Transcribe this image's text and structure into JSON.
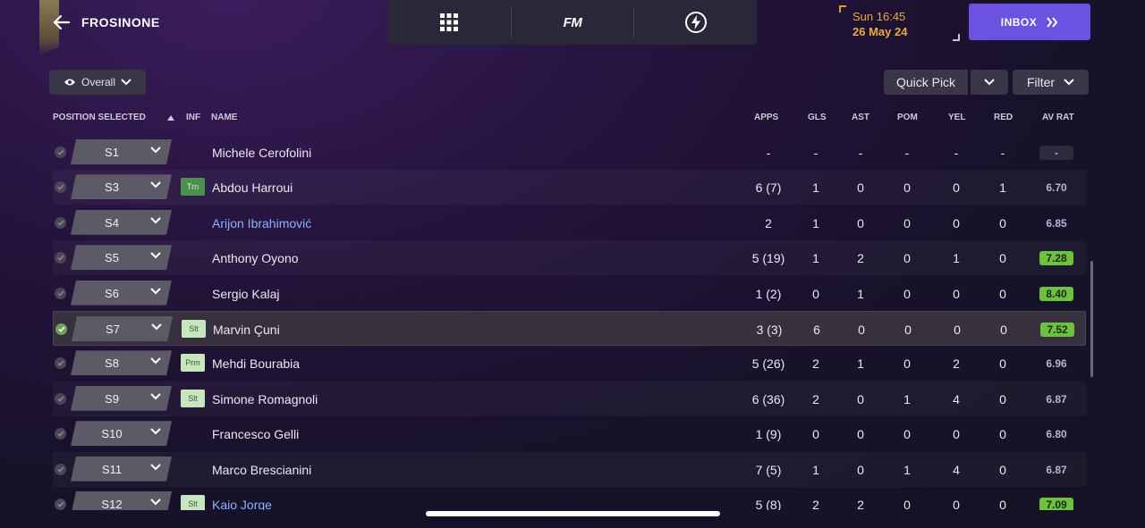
{
  "header": {
    "team_name": "FROSINONE",
    "fm_label": "FM",
    "date_time": "Sun 16:45",
    "date_day": "26 May 24",
    "inbox_label": "INBOX"
  },
  "toolbar": {
    "view_label": "Overall",
    "quick_pick_label": "Quick Pick",
    "filter_label": "Filter"
  },
  "columns": {
    "position": "POSITION SELECTED",
    "inf": "INF",
    "name": "NAME",
    "apps": "APPS",
    "gls": "GLS",
    "ast": "AST",
    "pom": "POM",
    "yel": "YEL",
    "red": "RED",
    "avrat": "AV RAT"
  },
  "players": [
    {
      "pos": "S1",
      "inf": "",
      "name": "Michele Cerofolini",
      "link": false,
      "apps": "-",
      "gls": "-",
      "ast": "-",
      "pom": "-",
      "yel": "-",
      "red": "-",
      "rat": "-",
      "rat_style": "muted",
      "selected": false
    },
    {
      "pos": "S3",
      "inf": "Trn",
      "name": "Abdou Harroui",
      "link": false,
      "apps": "6 (7)",
      "gls": "1",
      "ast": "0",
      "pom": "0",
      "yel": "0",
      "red": "1",
      "rat": "6.70",
      "rat_style": "plain",
      "selected": false
    },
    {
      "pos": "S4",
      "inf": "",
      "name": "Arijon Ibrahimović",
      "link": true,
      "apps": "2",
      "gls": "1",
      "ast": "0",
      "pom": "0",
      "yel": "0",
      "red": "0",
      "rat": "6.85",
      "rat_style": "plain",
      "selected": false
    },
    {
      "pos": "S5",
      "inf": "",
      "name": "Anthony Oyono",
      "link": false,
      "apps": "5 (19)",
      "gls": "1",
      "ast": "2",
      "pom": "0",
      "yel": "1",
      "red": "0",
      "rat": "7.28",
      "rat_style": "good",
      "selected": false
    },
    {
      "pos": "S6",
      "inf": "",
      "name": "Sergio Kalaj",
      "link": false,
      "apps": "1 (2)",
      "gls": "0",
      "ast": "1",
      "pom": "0",
      "yel": "0",
      "red": "0",
      "rat": "8.40",
      "rat_style": "good",
      "selected": false
    },
    {
      "pos": "S7",
      "inf": "Slt",
      "name": "Marvin Çuni",
      "link": false,
      "apps": "3 (3)",
      "gls": "6",
      "ast": "0",
      "pom": "0",
      "yel": "0",
      "red": "0",
      "rat": "7.52",
      "rat_style": "good",
      "selected": true
    },
    {
      "pos": "S8",
      "inf": "Prm",
      "name": "Mehdi Bourabia",
      "link": false,
      "apps": "5 (26)",
      "gls": "2",
      "ast": "1",
      "pom": "0",
      "yel": "2",
      "red": "0",
      "rat": "6.96",
      "rat_style": "plain",
      "selected": false
    },
    {
      "pos": "S9",
      "inf": "Slt",
      "name": "Simone Romagnoli",
      "link": false,
      "apps": "6 (36)",
      "gls": "2",
      "ast": "0",
      "pom": "1",
      "yel": "4",
      "red": "0",
      "rat": "6.87",
      "rat_style": "plain",
      "selected": false
    },
    {
      "pos": "S10",
      "inf": "",
      "name": "Francesco Gelli",
      "link": false,
      "apps": "1 (9)",
      "gls": "0",
      "ast": "0",
      "pom": "0",
      "yel": "0",
      "red": "0",
      "rat": "6.80",
      "rat_style": "plain",
      "selected": false
    },
    {
      "pos": "S11",
      "inf": "",
      "name": "Marco Brescianini",
      "link": false,
      "apps": "7 (5)",
      "gls": "1",
      "ast": "0",
      "pom": "1",
      "yel": "4",
      "red": "0",
      "rat": "6.87",
      "rat_style": "plain",
      "selected": false
    },
    {
      "pos": "S12",
      "inf": "Slt",
      "name": "Kaio Jorge",
      "link": true,
      "apps": "5 (8)",
      "gls": "2",
      "ast": "2",
      "pom": "0",
      "yel": "0",
      "red": "0",
      "rat": "7.09",
      "rat_style": "good",
      "selected": false
    }
  ],
  "icons": {
    "back": "arrow-left-icon",
    "grid": "grid-icon",
    "lightning": "lightning-icon",
    "eye": "eye-icon",
    "chevron": "chevron-down-icon",
    "inbox_arrows": "double-chevron-right-icon"
  },
  "colors": {
    "accent": "#6b52e0",
    "date": "#f0a640",
    "rating_good": "#6cc13e",
    "link": "#8bb3ff"
  }
}
